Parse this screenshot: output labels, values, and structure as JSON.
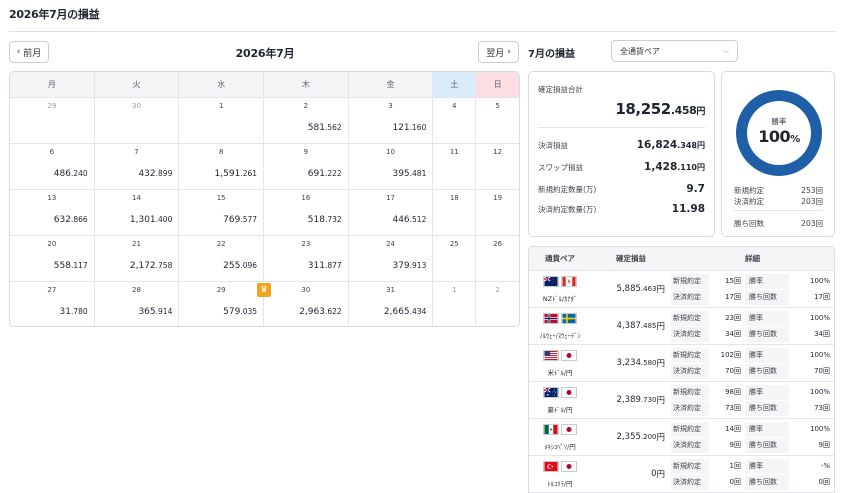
{
  "page": {
    "title": "2026年7月の損益"
  },
  "calendar": {
    "prev_label": "前月",
    "next_label": "翌月",
    "month_label": "2026年7月",
    "weekdays": [
      "月",
      "火",
      "水",
      "木",
      "金",
      "土",
      "日"
    ],
    "weeks": [
      [
        {
          "day": "29",
          "int": "",
          "dec": ""
        },
        {
          "day": "30",
          "int": "",
          "dec": ""
        },
        {
          "day": "1",
          "int": "",
          "dec": ""
        },
        {
          "day": "2",
          "int": "581",
          "dec": ".562"
        },
        {
          "day": "3",
          "int": "121",
          "dec": ".160"
        },
        {
          "day": "4",
          "int": "",
          "dec": ""
        },
        {
          "day": "5",
          "int": "",
          "dec": ""
        }
      ],
      [
        {
          "day": "6",
          "int": "486",
          "dec": ".240"
        },
        {
          "day": "7",
          "int": "432",
          "dec": ".899"
        },
        {
          "day": "8",
          "int": "1,591",
          "dec": ".261"
        },
        {
          "day": "9",
          "int": "691",
          "dec": ".222"
        },
        {
          "day": "10",
          "int": "395",
          "dec": ".481"
        },
        {
          "day": "11",
          "int": "",
          "dec": ""
        },
        {
          "day": "12",
          "int": "",
          "dec": ""
        }
      ],
      [
        {
          "day": "13",
          "int": "632",
          "dec": ".866"
        },
        {
          "day": "14",
          "int": "1,301",
          "dec": ".400"
        },
        {
          "day": "15",
          "int": "769",
          "dec": ".577"
        },
        {
          "day": "16",
          "int": "518",
          "dec": ".732"
        },
        {
          "day": "17",
          "int": "446",
          "dec": ".512"
        },
        {
          "day": "18",
          "int": "",
          "dec": ""
        },
        {
          "day": "19",
          "int": "",
          "dec": ""
        }
      ],
      [
        {
          "day": "20",
          "int": "558",
          "dec": ".117"
        },
        {
          "day": "21",
          "int": "2,172",
          "dec": ".758"
        },
        {
          "day": "22",
          "int": "255",
          "dec": ".096"
        },
        {
          "day": "23",
          "int": "311",
          "dec": ".877"
        },
        {
          "day": "24",
          "int": "379",
          "dec": ".913"
        },
        {
          "day": "25",
          "int": "",
          "dec": ""
        },
        {
          "day": "26",
          "int": "",
          "dec": ""
        }
      ],
      [
        {
          "day": "27",
          "int": "31",
          "dec": ".780"
        },
        {
          "day": "28",
          "int": "365",
          "dec": ".914"
        },
        {
          "day": "29",
          "int": "579",
          "dec": ".035"
        },
        {
          "day": "30",
          "int": "2,963",
          "dec": ".622",
          "crown": true
        },
        {
          "day": "31",
          "int": "2,665",
          "dec": ".434"
        },
        {
          "day": "1",
          "int": "",
          "dec": "",
          "muted": true
        },
        {
          "day": "2",
          "int": "",
          "dec": "",
          "muted": true
        }
      ]
    ],
    "muted_leading": [
      0,
      1
    ]
  },
  "summary": {
    "title": "7月の損益",
    "pair_select": "全通貨ペア",
    "total_label": "確定損益合計",
    "total_int": "18,252",
    "total_dec": ".458",
    "unit": "円",
    "settled_label": "決済損益",
    "settled_int": "16,824",
    "settled_dec": ".348",
    "swap_label": "スワップ損益",
    "swap_int": "1,428",
    "swap_dec": ".110",
    "new_qty_label": "新規約定数量(万)",
    "new_qty": "9.7",
    "close_qty_label": "決済約定数量(万)",
    "close_qty": "11.98"
  },
  "winrate": {
    "label": "勝率",
    "value": "100",
    "pct": "%",
    "percent": 100,
    "new_label": "新規約定",
    "new_value": "253回",
    "close_label": "決済約定",
    "close_value": "203回",
    "wins_label": "勝ち回数",
    "wins_value": "203回"
  },
  "pairs_table": {
    "headers": [
      "通貨ペア",
      "確定損益",
      "詳細"
    ],
    "rows": [
      {
        "name": "NZﾄﾞﾙ/ｶﾅﾀﾞ",
        "flags": [
          "nz",
          "ca"
        ],
        "int": "5,885",
        "dec": ".463",
        "unit": "円",
        "new_label": "新規約定",
        "new_value": "15回",
        "rate_label": "勝率",
        "rate_value": "100%",
        "close_label": "決済約定",
        "close_value": "17回",
        "wins_label": "勝ち回数",
        "wins_value": "17回"
      },
      {
        "name": "ﾉﾙｳｪｰ/ｽｳｪｰﾃﾞﾝ",
        "flags": [
          "no",
          "se"
        ],
        "int": "4,387",
        "dec": ".485",
        "unit": "円",
        "new_label": "新規約定",
        "new_value": "23回",
        "rate_label": "勝率",
        "rate_value": "100%",
        "close_label": "決済約定",
        "close_value": "34回",
        "wins_label": "勝ち回数",
        "wins_value": "34回"
      },
      {
        "name": "米ﾄﾞﾙ/円",
        "flags": [
          "us",
          "jp"
        ],
        "int": "3,234",
        "dec": ".580",
        "unit": "円",
        "new_label": "新規約定",
        "new_value": "102回",
        "rate_label": "勝率",
        "rate_value": "100%",
        "close_label": "決済約定",
        "close_value": "70回",
        "wins_label": "勝ち回数",
        "wins_value": "70回"
      },
      {
        "name": "豪ﾄﾞﾙ/円",
        "flags": [
          "au",
          "jp"
        ],
        "int": "2,389",
        "dec": ".730",
        "unit": "円",
        "new_label": "新規約定",
        "new_value": "98回",
        "rate_label": "勝率",
        "rate_value": "100%",
        "close_label": "決済約定",
        "close_value": "73回",
        "wins_label": "勝ち回数",
        "wins_value": "73回"
      },
      {
        "name": "ﾒｷｼｺﾍﾟｿ/円",
        "flags": [
          "mx",
          "jp"
        ],
        "int": "2,355",
        "dec": ".200",
        "unit": "円",
        "new_label": "新規約定",
        "new_value": "14回",
        "rate_label": "勝率",
        "rate_value": "100%",
        "close_label": "決済約定",
        "close_value": "9回",
        "wins_label": "勝ち回数",
        "wins_value": "9回"
      },
      {
        "name": "ﾄﾙｺﾘﾗ/円",
        "flags": [
          "tr",
          "jp"
        ],
        "int": "0",
        "dec": "",
        "unit": "円",
        "new_label": "新規約定",
        "new_value": "1回",
        "rate_label": "勝率",
        "rate_value": "-%",
        "close_label": "決済約定",
        "close_value": "0回",
        "wins_label": "勝ち回数",
        "wins_value": "0回"
      }
    ]
  },
  "colors": {
    "accent": "#1f5fa8",
    "saturday": "#d9ecf9",
    "sunday": "#fbdde3",
    "crown": "#f3a21c"
  }
}
